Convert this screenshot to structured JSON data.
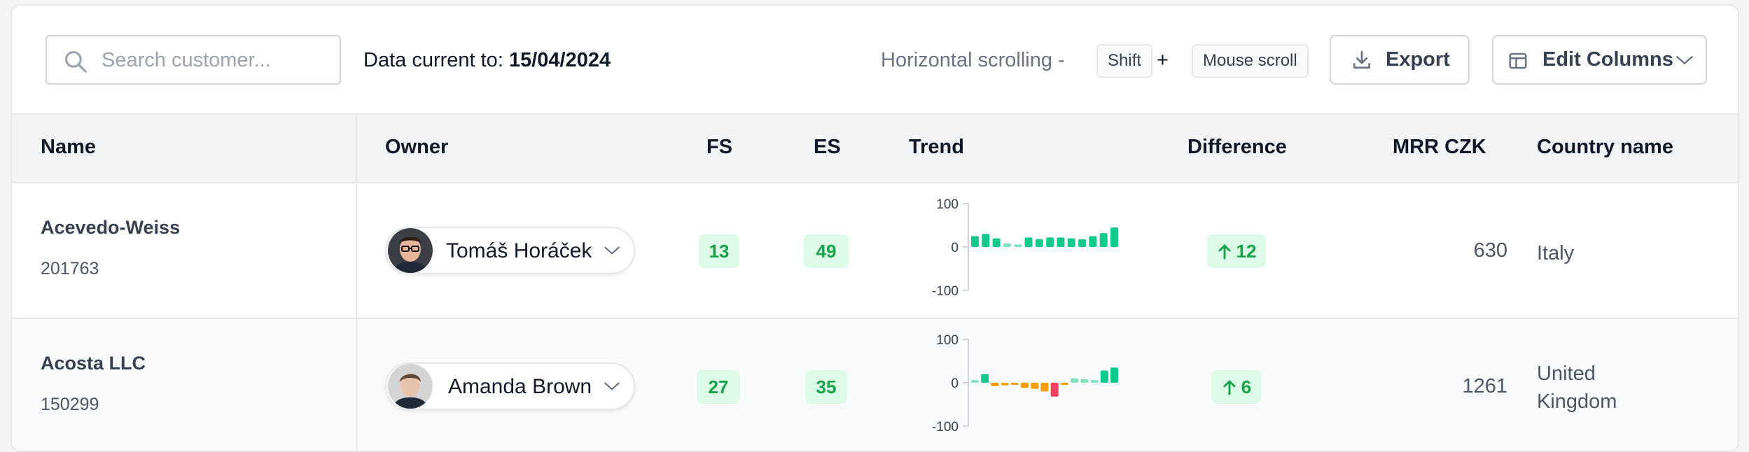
{
  "toolbar": {
    "search_placeholder": "Search customer...",
    "data_current_label": "Data current to:",
    "data_current_date": "15/04/2024",
    "hscroll_label": "Horizontal scrolling -",
    "kbd_shift": "Shift",
    "plus": "+",
    "kbd_mouse": "Mouse scroll",
    "export_label": "Export",
    "edit_columns_label": "Edit Columns"
  },
  "table": {
    "headers": {
      "name": "Name",
      "owner": "Owner",
      "fs": "FS",
      "es": "ES",
      "trend": "Trend",
      "difference": "Difference",
      "mrr": "MRR CZK",
      "country": "Country name"
    },
    "rows": [
      {
        "name": "Acevedo-Weiss",
        "id": "201763",
        "owner": "Tomáš Horáček",
        "fs": "13",
        "es": "49",
        "difference": "12",
        "mrr": "630",
        "country": "Italy",
        "trend": {
          "y_ticks": [
            "100",
            "0",
            "-100"
          ],
          "values": [
            25,
            30,
            20,
            8,
            6,
            22,
            18,
            22,
            22,
            20,
            18,
            25,
            32,
            45
          ]
        }
      },
      {
        "name": "Acosta LLC",
        "id": "150299",
        "owner": "Amanda Brown",
        "fs": "27",
        "es": "35",
        "difference": "6",
        "mrr": "1261",
        "country": "United Kingdom",
        "trend": {
          "y_ticks": [
            "100",
            "0",
            "-100"
          ],
          "values": [
            6,
            20,
            -8,
            -6,
            -3,
            -12,
            -14,
            -20,
            -32,
            -3,
            10,
            8,
            6,
            28,
            35
          ]
        }
      }
    ]
  },
  "colors": {
    "trend_green": "#10c98b",
    "trend_light_green": "#7ee3bd",
    "trend_orange": "#f59e0b",
    "trend_red": "#f43f5e",
    "pill_bg": "#dcfce7",
    "pill_text": "#16a34a"
  }
}
